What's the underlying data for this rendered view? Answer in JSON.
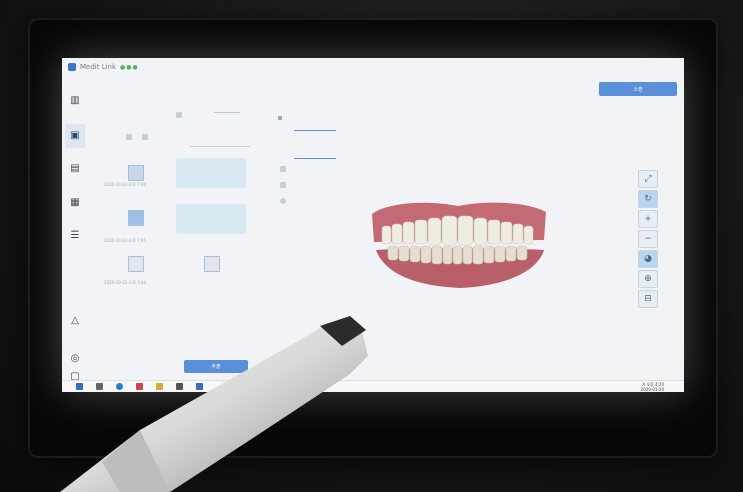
{
  "app": {
    "title": "Medit Link",
    "status_dots": "●●●",
    "top_button_label": "스캔",
    "bottom_button_label": "추출"
  },
  "list": {
    "cards": [
      {
        "label": "",
        "date": "2020-10-22 오후 7:40"
      },
      {
        "label": "",
        "date": "2020-10-22 오후 7:41"
      },
      {
        "label": "",
        "date": "2020-10-22 오후 7:44"
      }
    ]
  },
  "taskbar": {
    "time": "오후 4:20",
    "date": "2020-01-20",
    "ime": "A"
  },
  "icons": {
    "windows": "windows-icon",
    "search": "search-icon",
    "edge": "edge-icon",
    "store": "store-icon",
    "folder": "folder-icon",
    "mail": "mail-icon"
  },
  "colors": {
    "accent": "#5b8fd9",
    "screen": "#f2f3f6",
    "gum": "#c96f78",
    "teeth": "#ece8dc"
  }
}
